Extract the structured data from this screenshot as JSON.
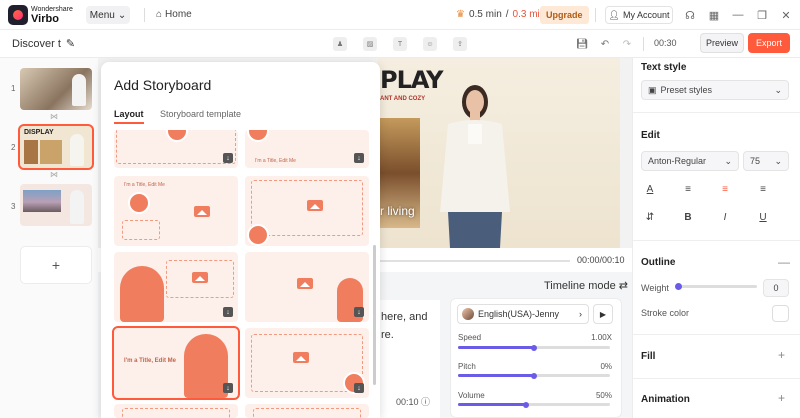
{
  "app": {
    "brand_line1": "Wondershare",
    "brand_line2": "Virbo",
    "menu_label": "Menu",
    "home_label": "Home"
  },
  "quota": {
    "used": "0.5 min",
    "separator": "/",
    "total": "0.3 min"
  },
  "upgrade_label": "Upgrade",
  "account_label": "My Account",
  "document": {
    "title": "Discover t"
  },
  "duration": "00:30",
  "preview_label": "Preview",
  "export_label": "Export",
  "scenes": [
    {
      "number": "1"
    },
    {
      "number": "2"
    },
    {
      "number": "3"
    }
  ],
  "stage": {
    "headline": "PLAY",
    "subline": "ANT AND COZY",
    "caption": "r living"
  },
  "playback": {
    "timecode": "00:00/00:10"
  },
  "timeline_mode_label": "Timeline mode ⇄",
  "script": {
    "text_line1": "here, and",
    "text_line2": "re.",
    "time": "00:10"
  },
  "voice": {
    "name": "English(USA)-Jenny",
    "speed_label": "Speed",
    "speed_value": "1.00X",
    "speed_level": 0.5,
    "pitch_label": "Pitch",
    "pitch_value": "0%",
    "pitch_level": 0.5,
    "volume_label": "Volume",
    "volume_value": "50%",
    "volume_level": 0.45
  },
  "storyboard": {
    "title": "Add Storyboard",
    "tabs": [
      "Layout",
      "Storyboard template"
    ],
    "card_title_text": "I'm a Title, Edit Me"
  },
  "right_panel": {
    "text_style_label": "Text style",
    "preset_styles_label": "Preset styles",
    "edit_label": "Edit",
    "font_name": "Anton-Regular",
    "font_size": "75",
    "outline_label": "Outline",
    "weight_label": "Weight",
    "weight_value": "0",
    "stroke_color_label": "Stroke color",
    "fill_label": "Fill",
    "animation_label": "Animation"
  },
  "colors": {
    "accent": "#ff5a3c",
    "slider": "#6b5ce7",
    "card_bg": "#fdf0ea",
    "card_shape": "#f07e5e"
  }
}
